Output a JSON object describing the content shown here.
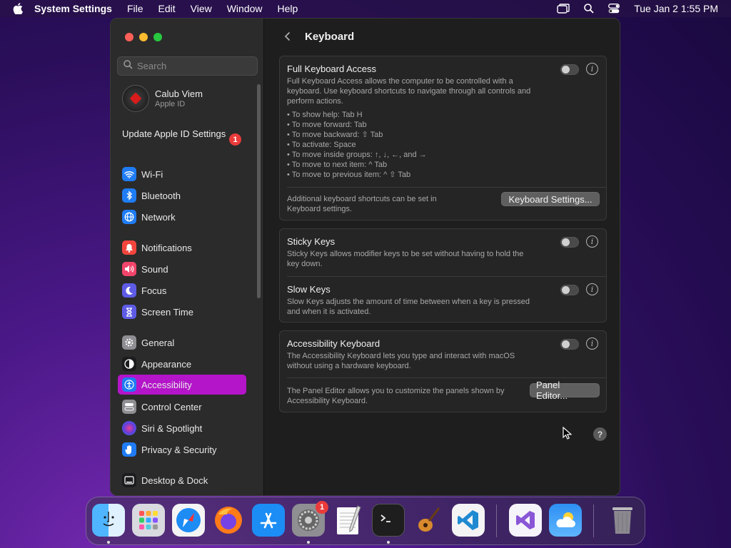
{
  "menubar": {
    "app_name": "System Settings",
    "menus": [
      "File",
      "Edit",
      "View",
      "Window",
      "Help"
    ],
    "clock": "Tue Jan 2  1:55 PM"
  },
  "sidebar": {
    "search_placeholder": "Search",
    "account": {
      "name": "Calub Viem",
      "subtitle": "Apple ID"
    },
    "update": {
      "label": "Update Apple ID Settings",
      "badge": "1"
    },
    "items": [
      {
        "label": "Wi-Fi",
        "icon": "wifi-icon",
        "color": "#1f7cf5"
      },
      {
        "label": "Bluetooth",
        "icon": "bluetooth-icon",
        "color": "#1f7cf5"
      },
      {
        "label": "Network",
        "icon": "globe-icon",
        "color": "#1f7cf5"
      },
      {
        "label": "Notifications",
        "icon": "bell-icon",
        "color": "#f2453d"
      },
      {
        "label": "Sound",
        "icon": "speaker-icon",
        "color": "#f2456b"
      },
      {
        "label": "Focus",
        "icon": "moon-icon",
        "color": "#5e5ce6"
      },
      {
        "label": "Screen Time",
        "icon": "hourglass-icon",
        "color": "#5e5ce6"
      },
      {
        "label": "General",
        "icon": "gear-icon",
        "color": "#8e8e93"
      },
      {
        "label": "Appearance",
        "icon": "appearance-icon",
        "color": "#1c1c1e"
      },
      {
        "label": "Accessibility",
        "icon": "accessibility-icon",
        "color": "#1f7cf5"
      },
      {
        "label": "Control Center",
        "icon": "control-center-icon",
        "color": "#8e8e93"
      },
      {
        "label": "Siri & Spotlight",
        "icon": "siri-icon",
        "color": "#6a3cd9"
      },
      {
        "label": "Privacy & Security",
        "icon": "hand-icon",
        "color": "#1f7cf5"
      },
      {
        "label": "Desktop & Dock",
        "icon": "dock-icon",
        "color": "#1c1c1e"
      }
    ],
    "active_item": "Accessibility",
    "active_color": "#b415c9"
  },
  "main": {
    "title": "Keyboard",
    "full_keyboard_access": {
      "title": "Full Keyboard Access",
      "description_1": "Full Keyboard Access allows the computer to be controlled with a",
      "description_2": "keyboard. Use keyboard shortcuts to navigate through all controls and",
      "description_3": "perform actions.",
      "bullets": [
        "• To show help: Tab H",
        "• To move forward: Tab",
        "• To move backward: ⇧ Tab",
        "• To activate: Space",
        "• To move inside groups: ↑, ↓, ←, and →",
        "• To move to next item: ^ Tab",
        "• To move to previous item: ^ ⇧ Tab"
      ],
      "enabled": false,
      "additional_1": "Additional keyboard shortcuts can be set in",
      "additional_2": "Keyboard settings.",
      "button": "Keyboard Settings..."
    },
    "sticky_keys": {
      "title": "Sticky Keys",
      "description_1": "Sticky Keys allows modifier keys to be set without having to hold the",
      "description_2": "key down.",
      "enabled": false
    },
    "slow_keys": {
      "title": "Slow Keys",
      "description_1": "Slow Keys adjusts the amount of time between when a key is pressed",
      "description_2": "and when it is activated.",
      "enabled": false
    },
    "accessibility_keyboard": {
      "title": "Accessibility Keyboard",
      "description_1": "The Accessibility Keyboard lets you type and interact with macOS",
      "description_2": "without using a hardware keyboard.",
      "enabled": false,
      "panel_text_1": "The Panel Editor allows you to customize the panels shown by",
      "panel_text_2": "Accessibility Keyboard.",
      "button": "Panel Editor..."
    },
    "help_label": "?"
  },
  "dock": {
    "apps": [
      "Finder",
      "Launchpad",
      "Safari",
      "Firefox",
      "App Store",
      "System Settings",
      "TextEdit",
      "Terminal",
      "GarageBand",
      "Visual Studio Code",
      "Visual Studio",
      "Weather",
      "Trash"
    ],
    "system_settings_badge": "1"
  }
}
